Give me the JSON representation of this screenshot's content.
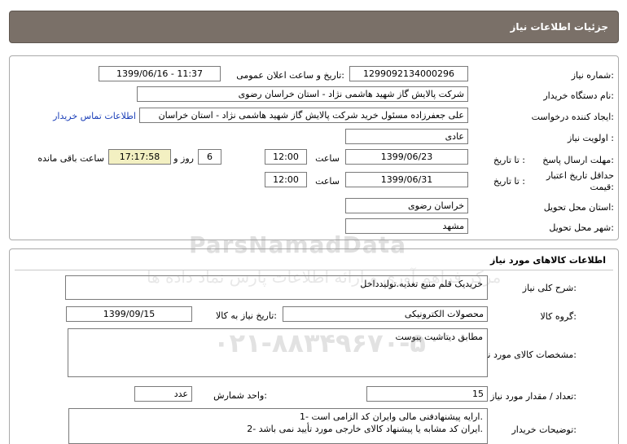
{
  "header": {
    "title": "جزئیات اطلاعات نیاز"
  },
  "info": {
    "need_number_label": "شماره نیاز:",
    "need_number": "1299092134000296",
    "announce_label": "تاریخ و ساعت اعلان عمومی:",
    "announce_value": "1399/06/16 - 11:37",
    "buyer_org_label": "نام دستگاه خریدار:",
    "buyer_org": "شرکت پالایش گاز شهید هاشمی نژاد - استان خراسان رضوی",
    "requester_label": "ایجاد کننده درخواست:",
    "requester": "علی جعفرزاده مسئول خرید شرکت پالایش گاز شهید هاشمی نژاد - استان خراسان",
    "contact_link": "اطلاعات تماس خریدار",
    "priority_label": "اولویت نیاز :",
    "priority": "عادی",
    "deadline_label": "مهلت ارسال پاسخ:",
    "to_date_label": "تا تاریخ :",
    "deadline_date": "1399/06/23",
    "time_label": "ساعت",
    "deadline_time": "12:00",
    "days_value": "6",
    "days_label": "روز و",
    "remaining_time": "17:17:58",
    "remaining_label": "ساعت باقی مانده",
    "price_validity_label": "حداقل تاریخ اعتبار قیمت:",
    "validity_to_label": "تا تاریخ :",
    "validity_date": "1399/06/31",
    "validity_time_label": "ساعت",
    "validity_time": "12:00",
    "province_label": "استان محل تحویل:",
    "province": "خراسان رضوی",
    "city_label": "شهر محل تحویل:",
    "city": "مشهد"
  },
  "goods": {
    "section_title": "اطلاعات کالاهای مورد نیاز",
    "summary_label": "شرح کلی نیاز:",
    "summary": "خریدیک قلم منبع تغذیه.تولیدداخل",
    "group_label": "گروه کالا:",
    "group": "محصولات الکترونیکی",
    "need_date_label": "تاریخ نیاز به کالا:",
    "need_date": "1399/09/15",
    "specs_label": "مشخصات کالای مورد نیاز:",
    "specs": "مطابق دیتاشیت پیوست",
    "quantity_label": "تعداد / مقدار مورد نیاز:",
    "quantity": "15",
    "unit_label": "واحد شمارش:",
    "unit": "عدد",
    "notes_label": "توضیحات خریدار:",
    "note_1": "1- ارایه پیشنهادفنی مالی وایران کد الزامی است.",
    "note_2": "2- ایران کد مشابه یا پیشنهاد کالای خارجی مورد تأیید نمی باشد."
  },
  "watermark": {
    "brand": "ParsNamadData",
    "tagline": "مرکز فراهم آوری و ارائه اطلاعات پارس نماد داده ها",
    "phone": "۰۲۱-۸۸۳۴۹۶۷۰-۵"
  }
}
